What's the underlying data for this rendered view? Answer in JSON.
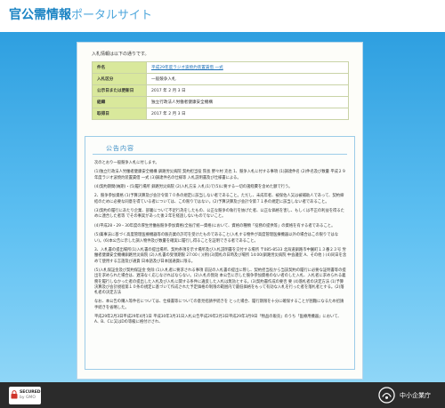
{
  "header": {
    "title_main": "官公需情報",
    "title_sub": "ポータルサイト"
  },
  "panel": {
    "intro": "入札情報は以下の通りです。",
    "info_rows": [
      {
        "label": "件名",
        "value": "平成29年度ラジオ波焼灼装置賃借 一式"
      },
      {
        "label": "入札区分",
        "value": "一般競争入札"
      },
      {
        "label": "公示日または更新日",
        "value": "2017 年 2 月 3 日"
      },
      {
        "label": "組織",
        "value": "独立行政法人労働者健康安全機構"
      },
      {
        "label": "取得日",
        "value": "2017 年 2 月 3 日"
      }
    ]
  },
  "notice": {
    "title": "公告内容",
    "paragraphs": [
      "次のとおり一般競争入札に付します。",
      "(1)独立行政法人労働者健康安全機構 釧路労災病院 契約担当役 院長 野々村 克也 1、競争入札に付する事項 (1)調達件名 (2)件名及び数量 平成２９年度ラジオ波焼灼装置賃借 一式 (3)調達件名の仕様等 入札説明書及び仕様書による。",
      "(4)契約期間(納期)・(5)履行場所 釧路労災病院 (2)入札方法 入札(1)で(5)に要する一切の諸経費を含めた額で行う。",
      "2、競争参加資格 (1)予算決算及び会計令第７０条の規定に該当しない者であること。ただし、未成年者、被保佐人又は被補助人であって、契約締結のために必要な同意を得ている者については、この限りではない。(2)予算決算及び会計令第７１条の規定に該当しない者であること。",
      "(3)契約の履行にあたり企業、部署について不足行為をしたもの、公正な競争の執行を妨げた者、公正な価格を害し、もしくは不正の利益を得るために連合した者等 でその事実があった後２年を経過しないものでないこと。",
      "(4)平成28・29・30年度の厚生労働省競争参加資格(全省庁統一資格)において、資格の種類「役務の提供等」の資格を有する者であること。",
      "(5)薬事法に基づく高度管理医療機器等の販売業の許可を受けたものであること(入札する物件が高度管理医療機器以外の場合はこの限りではない)。(6)本公告に示した調入物件及び数量を確実に履行し得ることを証明できる者であること。",
      "3、入札書の提出場所(1)入札書の提出場所、契約条項を示す場所及び入札説明書を交付する場所 〒085-8533 北海道釧路市中園町１３番２３号 労働者健康安全機構釧路労災病院 (2)入札書の受領期限 27:00 ( )(例)(3)開札の日時及び場所 14:00(釧路労災病院 中会議室 A、その他 ) (4)同日を含めて使用する言語及び通貨 日本語及び日本国通貨に限る。",
      "(5)入札保証金及び契約保証金 免除 (1)入札者に要求される事項 前記の入札書の提出に際し、契約担当役から当該契約の履行に必要な証明書等の提出を求められた場合は、遅滞なく応じなければならない。(2)入札の無効 本公告に示した競争参加資格のない者のした入札、入札者に求められる義務を履行しなかった者の提出した入札及び入札に関する条件に違反した入札は無効とする。(3)契約書作成の要否 要 (4)落札者の決定方法 (1)予算決算及び会計規程第１０条の規定に基づいて作成された予定価格の制限の範囲内で最低価格をもって有効な入札を行った者を落札者とする。(2)落札者の決定方法",
      "なお、本公告の購入等件名については、仕様書等についての意見招請手続きを とった場合、履行期限を十分に確保することが困難になるため招請手続きを省略した。",
      "平成29年2月3日平成29年4月1日 平成30年3月31日入札公告平成29年2月3日平成29年3月9日「物品の販売」のうち「医療用機器」において、A、B、Cに又はDの等級に格付けされ、"
    ]
  },
  "footer": {
    "secured_label": "SECURED",
    "secured_sub": "by GMO",
    "org_name": "中小企業庁"
  },
  "colors": {
    "title_blue": "#1b84c4",
    "key_cell_green": "#d9e89c",
    "footer_bg": "#2b2b2b"
  }
}
